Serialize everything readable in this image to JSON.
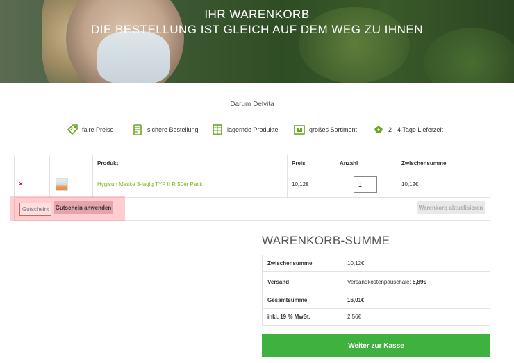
{
  "hero": {
    "line1": "IHR WARENKORB",
    "line2": "DIE BESTELLUNG IST GLEICH AUF DEM WEG ZU IHNEN"
  },
  "brand": "Darum Delvita",
  "features": [
    {
      "icon": "price-tag-icon",
      "label": "faire Preise"
    },
    {
      "icon": "secure-order-icon",
      "label": "sichere Bestellung"
    },
    {
      "icon": "stock-products-icon",
      "label": "lagernde Produkte"
    },
    {
      "icon": "assortment-icon",
      "label": "großes Sortiment"
    },
    {
      "icon": "delivery-icon",
      "label": "2 - 4 Tage Lieferzeit"
    }
  ],
  "cart": {
    "headers": {
      "produkt": "Produkt",
      "preis": "Preis",
      "anzahl": "Anzahl",
      "zwischensumme": "Zwischensumme"
    },
    "rows": [
      {
        "remove": "×",
        "product": "Hygisun Maske 3-lagig TYP II R 50er Pack",
        "price": "10,12€",
        "quantity": "1",
        "subtotal": "10,12€"
      }
    ],
    "coupon_placeholder": "Gutscheincode",
    "coupon_button": "Gutschein anwenden",
    "update_button": "Warenkorb aktualisieren"
  },
  "totals": {
    "title": "WARENKORB-SUMME",
    "rows": [
      {
        "label": "Zwischensumme",
        "value": "10,12€"
      },
      {
        "label": "Versand",
        "value_prefix": "Versandkostenpauschale:",
        "value": "5,89€"
      },
      {
        "label": "Gesamtsumme",
        "value": "16,01€"
      },
      {
        "label": "inkl. 19 % MwSt.",
        "value": "2,56€"
      }
    ],
    "checkout_button": "Weiter zur Kasse"
  },
  "colors": {
    "accent_green": "#3fb13f",
    "link_green": "#7ab317",
    "remove_red": "#d0021b"
  }
}
